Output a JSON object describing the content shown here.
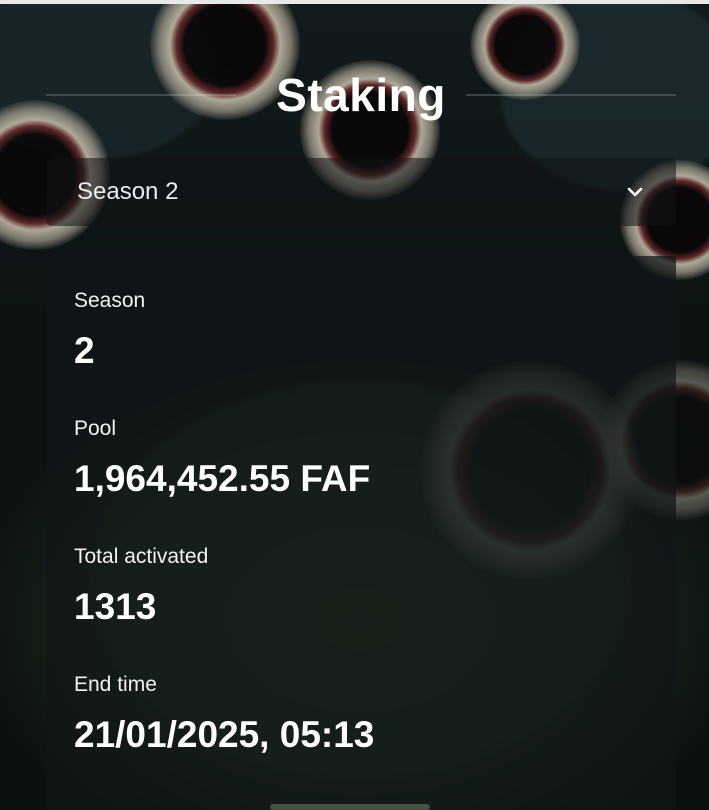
{
  "header": {
    "title": "Staking"
  },
  "season_select": {
    "selected": "Season 2",
    "icon": "chevron-down-icon"
  },
  "details": {
    "season": {
      "label": "Season",
      "value": "2"
    },
    "pool": {
      "label": "Pool",
      "value": "1,964,452.55 FAF"
    },
    "total_activated": {
      "label": "Total activated",
      "value": "1313"
    },
    "end_time": {
      "label": "End time",
      "value": "21/01/2025, 05:13"
    }
  },
  "colors": {
    "text": "#ffffff",
    "card_background": "#111618",
    "accent_green": "#2f4a2c"
  }
}
